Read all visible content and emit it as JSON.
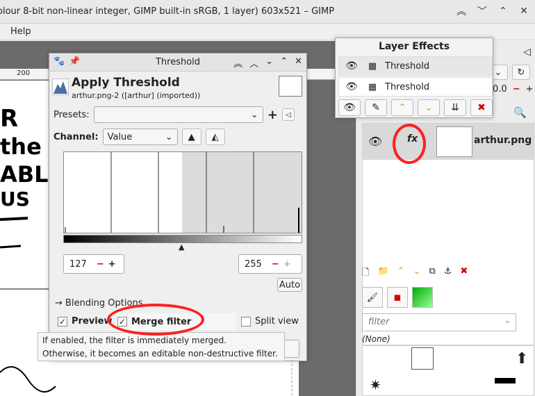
{
  "window": {
    "title": "olour 8-bit non-linear integer, GIMP built-in sRGB, 1 layer) 603x521 – GIMP"
  },
  "menubar": {
    "help": "Help"
  },
  "ruler": {
    "mark": "200"
  },
  "dialog": {
    "title": "Threshold",
    "header": "Apply Threshold",
    "subtitle": "arthur.png-2 ([arthur] (imported))",
    "presets_label": "Presets:",
    "channel_label": "Channel:",
    "channel_value": "Value",
    "low_value": "127",
    "high_value": "255",
    "auto_label": "Auto",
    "blending_label": "Blending Options",
    "preview_label": "Preview",
    "merge_label": "Merge filter",
    "split_label": "Split view",
    "tooltip_line1": "If enabled, the filter is immediately merged.",
    "tooltip_line2": "Otherwise, it becomes an editable non-destructive filter."
  },
  "effects": {
    "title": "Layer Effects",
    "items": [
      {
        "label": "Threshold"
      },
      {
        "label": "Threshold"
      }
    ]
  },
  "layers": {
    "name": "arthur.png",
    "fx_label": "fx",
    "opacity_readout": "0.0"
  },
  "brushes": {
    "filter_placeholder": "filter",
    "none_label": "(None)"
  },
  "colors": {
    "annotation": "#ff1f1f",
    "delete": "#dd0000",
    "arrow": "#f08c2e"
  }
}
